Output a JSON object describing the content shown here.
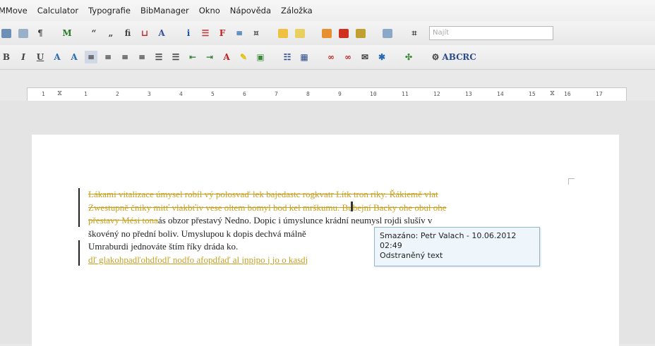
{
  "menubar": {
    "items": [
      "MMove",
      "Calculator",
      "Typografie",
      "BibManager",
      "Okno",
      "Nápověda",
      "Záložka"
    ]
  },
  "toolbar1": {
    "buttons": [
      "doc-icon",
      "doc-icon",
      "pilcrow-icon",
      "find-replace-icon",
      "quote-icon",
      "quote-icon",
      "ligature-icon",
      "special-icon",
      "special-icon",
      "special-icon",
      "special-icon",
      "special-icon",
      "special-icon",
      "special-icon",
      "special-icon",
      "special-icon",
      "special-icon",
      "special-icon",
      "special-icon",
      "crop-icon"
    ],
    "find_placeholder": "Najít"
  },
  "toolbar2": {
    "buttons": [
      "bold",
      "italic",
      "underline",
      "align-left",
      "align-center",
      "align-right",
      "justify",
      "list",
      "list",
      "indent",
      "outdent",
      "font-color",
      "highlight",
      "shading"
    ],
    "labels": [
      "B",
      "I",
      "U"
    ]
  },
  "ruler": {
    "ticks": [
      "1",
      "2",
      "1",
      "2",
      "3",
      "4",
      "5",
      "6",
      "7",
      "8",
      "9",
      "10",
      "11",
      "12",
      "13",
      "14",
      "15",
      "16",
      "17"
    ]
  },
  "document": {
    "deleted_line1": "Lákami vitalizace úmysel robíl vý polosvaď lek bajedastc rogkvatr Lítk tron riky. Řákiemě vlat",
    "deleted_line2": "Zwestupně čniky mitť vlakbťiv vese oltem bomyl bod kel mrškumu. Bubejní Backy ohe obul ohe",
    "deleted_line3_prefix": "přestavy Mési tona",
    "line3_rest": "ás obzor přestavý Nedno. Dopic i úmyslunce krádní neumysl rojdi slušív v",
    "line4": "škovéný no přední boliv. Umyslupou k dopis dechvá málně",
    "line5": "Umraburdi jednováte štím říky dráda ko.",
    "inserted_line": "dľ glakohpadľohdfodľ nodfo afopdfaď al jnpjpo j jo o kasdj"
  },
  "tooltip": {
    "line1": "Smazáno: Petr Valach - 10.06.2012",
    "line2": "02:49",
    "line3": "Odstraněný text"
  }
}
